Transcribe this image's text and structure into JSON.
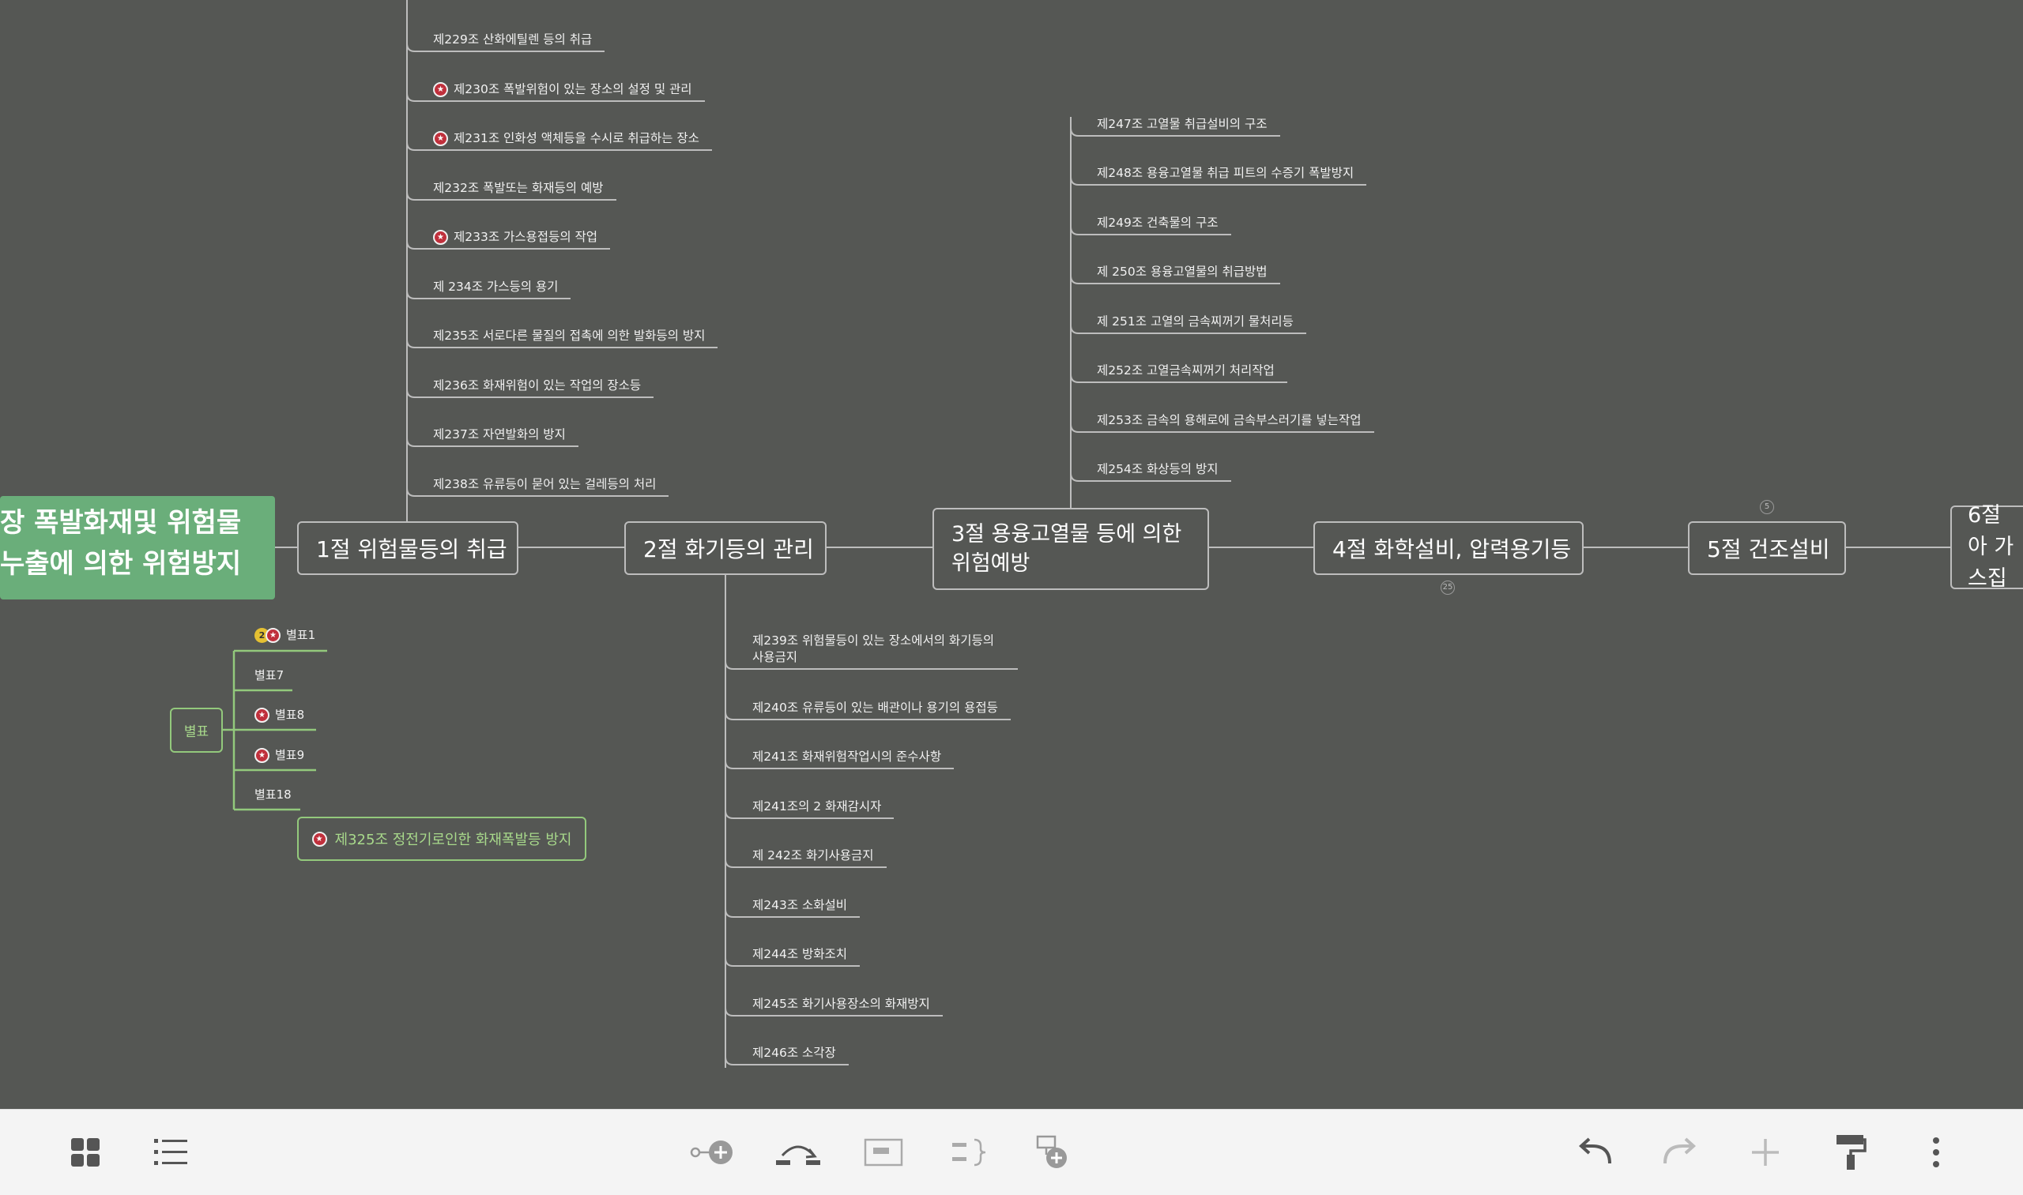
{
  "central_topic": [
    "장 폭발화재및 위험물",
    "누출에 의한 위험방지"
  ],
  "branches": {
    "b1": "1절 위험물등의 취급",
    "b2": "2절 화기등의 관리",
    "b3": "3절 용융고열물 등에 의한 위험예방",
    "b4": "4절 화학설비, 압력용기등",
    "b5": "5절 건조설비",
    "b6": "6절 아 가스집"
  },
  "b1_children": [
    "제229조 산화에틸렌 등의 취급",
    "제230조 폭발위험이 있는 장소의 설정 및 관리",
    "제231조 인화성 액체등을 수시로 취급하는 장소",
    "제232조 폭발또는 화재등의 예방",
    "제233조 가스용접등의 작업",
    "제 234조 가스등의 용기",
    "제235조 서로다른 물질의 접촉에 의한 발화등의 방지",
    "제236조 화재위험이 있는 작업의 장소등",
    "제237조 자연발화의 방지",
    "제238조 유류등이 묻어 있는 걸레등의 처리"
  ],
  "b2_children": [
    "제239조 위험물등이 있는 장소에서의 화기등의 사용금지",
    "제240조 유류등이 있는 배관이나 용기의 용접등",
    "제241조 화재위험작업시의 준수사항",
    "제241조의 2 화재감시자",
    "제 242조 화기사용금지",
    "제243조 소화설비",
    "제244조 방화조치",
    "제245조 화기사용장소의 화재방지",
    "제246조 소각장"
  ],
  "b3_children": [
    "제247조 고열물 취급설비의 구조",
    "제248조 용융고열물 취급 피트의 수증기 폭발방지",
    "제249조 건축물의 구조",
    "제 250조 용융고열물의 취급방법",
    "제 251조 고열의 금속찌꺼기 물처리등",
    "제252조 고열금속찌꺼기 처리작업",
    "제253조 금속의 용해로에 금속부스러기를 넣는작업",
    "제254조 화상등의 방지"
  ],
  "appendix": {
    "label": "별표",
    "items": [
      "별표1",
      "별표7",
      "별표8",
      "별표9",
      "별표18"
    ],
    "badge_number": "2"
  },
  "floating_topic": "제325조 정전기로인한 화재폭발등 방지",
  "collapse_counts": {
    "b4": "25",
    "b5": "5"
  },
  "toolbar": {
    "left": [
      "grid-view",
      "outline-view"
    ],
    "center": [
      "add-subtopic",
      "add-relationship",
      "add-summary-box",
      "add-boundary",
      "add-floating-topic"
    ],
    "right": [
      "undo",
      "redo",
      "add-topic",
      "format-painter",
      "more-menu"
    ]
  },
  "colors": {
    "canvas": "#555754",
    "central": "#6aae7a",
    "green_line": "#93c97c",
    "star": "#c0303c"
  }
}
